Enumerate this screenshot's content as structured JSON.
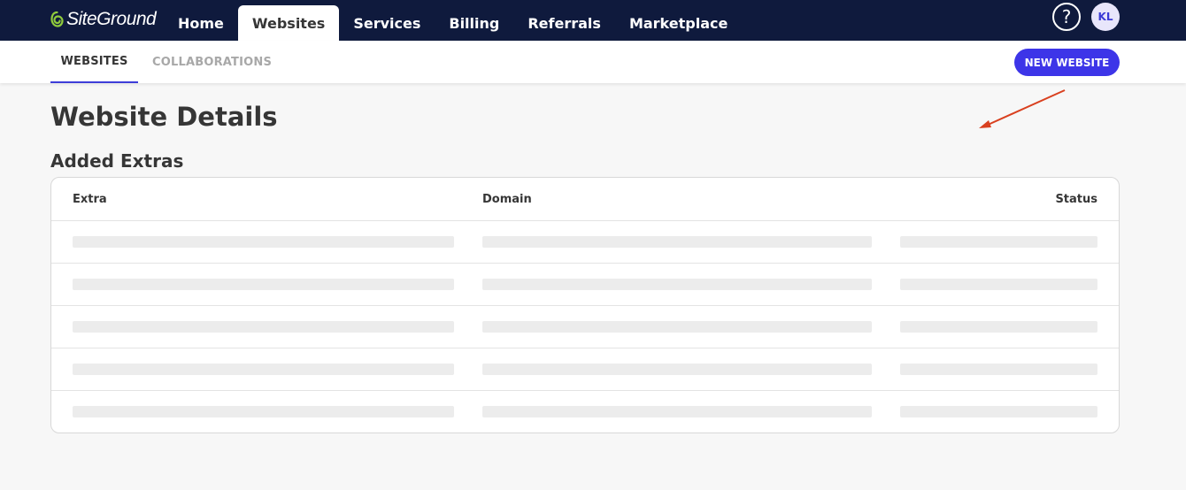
{
  "header": {
    "logo_text": "SiteGround",
    "nav": [
      {
        "label": "Home"
      },
      {
        "label": "Websites"
      },
      {
        "label": "Services"
      },
      {
        "label": "Billing"
      },
      {
        "label": "Referrals"
      },
      {
        "label": "Marketplace"
      }
    ],
    "help_label": "?",
    "avatar_initials": "KL"
  },
  "subnav": {
    "tabs": [
      {
        "label": "WEBSITES"
      },
      {
        "label": "COLLABORATIONS"
      }
    ],
    "new_website_label": "NEW WEBSITE"
  },
  "main": {
    "title": "Website Details",
    "section_title": "Added Extras",
    "table": {
      "headers": {
        "extra": "Extra",
        "domain": "Domain",
        "status": "Status"
      }
    }
  },
  "colors": {
    "topbar": "#0f1a3d",
    "accent": "#3d35e8",
    "annotation_arrow": "#d9401f"
  }
}
